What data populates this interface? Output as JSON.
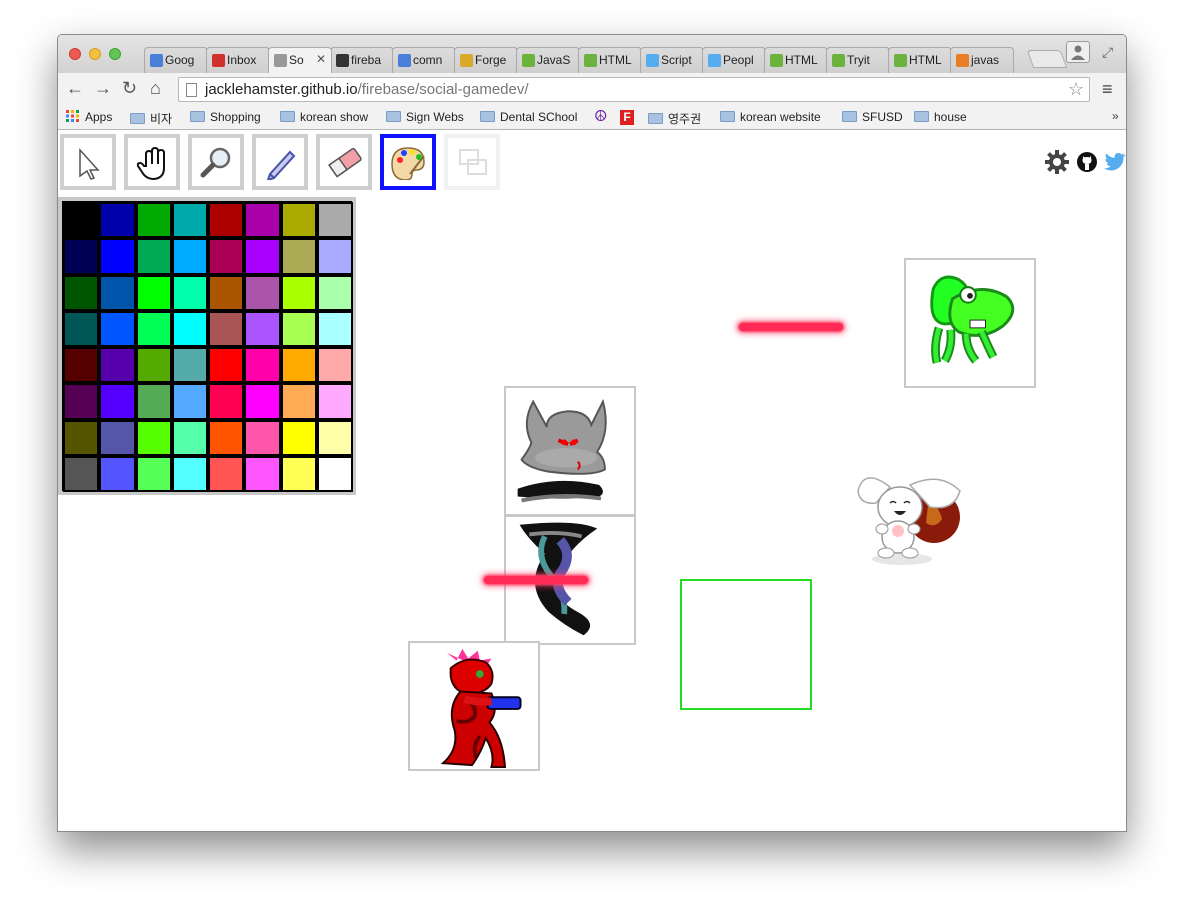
{
  "browser": {
    "tabs": [
      {
        "label": "Goog",
        "favicon": "google-icon",
        "color": "#4a7fd9",
        "active": false
      },
      {
        "label": "Inbox",
        "favicon": "gmail-icon",
        "color": "#d0312d",
        "active": false
      },
      {
        "label": "So",
        "favicon": "page-icon",
        "color": "#999999",
        "active": true
      },
      {
        "label": "fireba",
        "favicon": "github-icon",
        "color": "#333333",
        "active": false
      },
      {
        "label": "comn",
        "favicon": "google-icon",
        "color": "#4a7fd9",
        "active": false
      },
      {
        "label": "Forge",
        "favicon": "forge-icon",
        "color": "#d9a82b",
        "active": false
      },
      {
        "label": "JavaS",
        "favicon": "w3-icon",
        "color": "#6cb33e",
        "active": false
      },
      {
        "label": "HTML",
        "favicon": "w3-icon",
        "color": "#6cb33e",
        "active": false
      },
      {
        "label": "Script",
        "favicon": "twitter-icon",
        "color": "#55acee",
        "active": false
      },
      {
        "label": "Peopl",
        "favicon": "twitter-icon",
        "color": "#55acee",
        "active": false
      },
      {
        "label": "HTML",
        "favicon": "w3-icon",
        "color": "#6cb33e",
        "active": false
      },
      {
        "label": "Tryit",
        "favicon": "w3-icon",
        "color": "#6cb33e",
        "active": false
      },
      {
        "label": "HTML",
        "favicon": "w3-icon",
        "color": "#6cb33e",
        "active": false
      },
      {
        "label": "javas",
        "favicon": "stackoverflow-icon",
        "color": "#e87d26",
        "active": false
      }
    ],
    "close_glyph": "✕",
    "url_host": "jacklehamster.github.io",
    "url_path": "/firebase/social-gamedev/",
    "bookmarks": [
      {
        "label": "Apps",
        "type": "apps"
      },
      {
        "label": "비자",
        "type": "folder"
      },
      {
        "label": "Shopping",
        "type": "folder"
      },
      {
        "label": "korean show",
        "type": "folder"
      },
      {
        "label": "Sign Webs",
        "type": "folder"
      },
      {
        "label": "Dental SChool",
        "type": "folder"
      },
      {
        "label": "",
        "type": "peace-icon"
      },
      {
        "label": "",
        "type": "f-icon"
      },
      {
        "label": "영주권",
        "type": "folder"
      },
      {
        "label": "korean website",
        "type": "folder"
      },
      {
        "label": "SFUSD",
        "type": "folder"
      },
      {
        "label": "house",
        "type": "folder"
      }
    ],
    "bookmarks_more": "»"
  },
  "app": {
    "tools": [
      {
        "name": "select-tool",
        "icon": "arrow-cursor-icon",
        "selected": false,
        "disabled": false
      },
      {
        "name": "hand-tool",
        "icon": "hand-icon",
        "selected": false,
        "disabled": false
      },
      {
        "name": "zoom-tool",
        "icon": "magnifier-icon",
        "selected": false,
        "disabled": false
      },
      {
        "name": "pencil-tool",
        "icon": "pencil-icon",
        "selected": false,
        "disabled": false
      },
      {
        "name": "eraser-tool",
        "icon": "eraser-icon",
        "selected": false,
        "disabled": false
      },
      {
        "name": "palette-tool",
        "icon": "paint-palette-icon",
        "selected": true,
        "disabled": false
      },
      {
        "name": "layers-tool",
        "icon": "layers-icon",
        "selected": false,
        "disabled": true
      }
    ],
    "header_icons": [
      "gear-icon",
      "github-icon",
      "twitter-icon"
    ],
    "palette_colors": [
      "#000000",
      "#0000aa",
      "#00aa00",
      "#00aaaa",
      "#aa0000",
      "#aa00aa",
      "#aaaa00",
      "#aaaaaa",
      "#000055",
      "#0000ff",
      "#00aa55",
      "#00aaff",
      "#aa0055",
      "#aa00ff",
      "#aaaa55",
      "#aaaaff",
      "#005500",
      "#0055aa",
      "#00ff00",
      "#00ffaa",
      "#aa5500",
      "#aa55aa",
      "#aaff00",
      "#aaffaa",
      "#005555",
      "#0055ff",
      "#00ff55",
      "#00ffff",
      "#aa5555",
      "#aa55ff",
      "#aaff55",
      "#aaffff",
      "#550000",
      "#5500aa",
      "#55aa00",
      "#55aaaa",
      "#ff0000",
      "#ff00aa",
      "#ffaa00",
      "#ffaaaa",
      "#550055",
      "#5500ff",
      "#55aa55",
      "#55aaff",
      "#ff0055",
      "#ff00ff",
      "#ffaa55",
      "#ffaaff",
      "#555500",
      "#5555aa",
      "#55ff00",
      "#55ffaa",
      "#ff5500",
      "#ff55aa",
      "#ffff00",
      "#ffffaa",
      "#555555",
      "#5555ff",
      "#55ff55",
      "#55ffff",
      "#ff5555",
      "#ff55ff",
      "#ffff55",
      "#ffffff"
    ],
    "selection_color": "#22dd22",
    "laser_color": "#ff2a55"
  }
}
